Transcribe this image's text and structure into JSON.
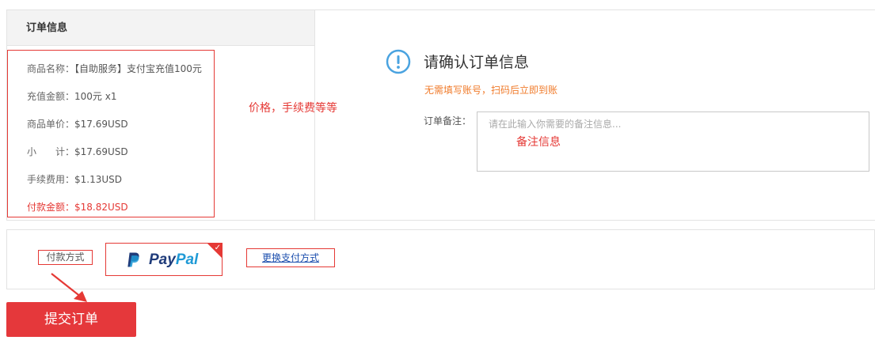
{
  "order_info": {
    "header": "订单信息",
    "rows": [
      {
        "label": "商品名称：",
        "value": "【自助服务】支付宝充值100元"
      },
      {
        "label": "充值金额：",
        "value": "100元  x1"
      },
      {
        "label": "商品单价：",
        "value": "$17.69USD"
      },
      {
        "label": "小　　计：",
        "value": "$17.69USD"
      },
      {
        "label": "手续费用：",
        "value": "$1.13USD"
      },
      {
        "label": "付款金额：",
        "value": "$18.82USD"
      }
    ]
  },
  "annotations": {
    "price_note": "价格，手续费等等",
    "remark_note": "备注信息"
  },
  "confirm": {
    "title": "请确认订单信息",
    "subtitle": "无需填写账号，扫码后立即到账",
    "remark_label": "订单备注：",
    "remark_placeholder": "请在此输入你需要的备注信息..."
  },
  "payment": {
    "label": "付款方式",
    "method_pay": "Pay",
    "method_pal": "Pal",
    "change_link": "更换支付方式",
    "selected_check": "✓"
  },
  "submit": {
    "label": "提交订单"
  },
  "colors": {
    "accent_red": "#e53935",
    "hint_orange": "#f07b2b",
    "paypal_dark": "#1f3b7a",
    "paypal_light": "#1f9ad6",
    "info_blue": "#4aa3e0"
  },
  "icons": {
    "confirm": "info-icon",
    "paypal": "paypal-logo-icon",
    "arrow": "annotation-arrow-icon"
  }
}
